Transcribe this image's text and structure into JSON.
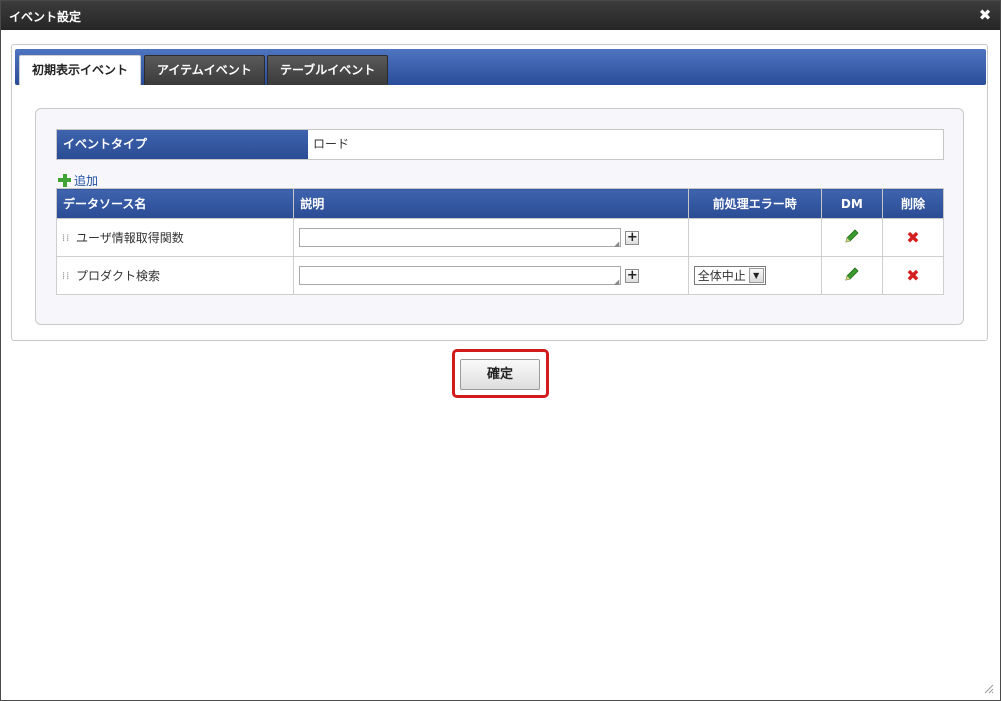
{
  "dialog": {
    "title": "イベント設定",
    "close_symbol": "✖"
  },
  "tabs": [
    {
      "label": "初期表示イベント",
      "active": true
    },
    {
      "label": "アイテムイベント",
      "active": false
    },
    {
      "label": "テーブルイベント",
      "active": false
    }
  ],
  "event_type": {
    "label": "イベントタイプ",
    "value": "ロード"
  },
  "add_link": {
    "label": "追加"
  },
  "table": {
    "columns": [
      "データソース名",
      "説明",
      "前処理エラー時",
      "DM",
      "削除"
    ],
    "rows": [
      {
        "name": "ユーザ情報取得関数",
        "description": "",
        "on_error": ""
      },
      {
        "name": "プロダクト検索",
        "description": "",
        "on_error": "全体中止"
      }
    ]
  },
  "confirm_button": {
    "label": "確定"
  },
  "colors": {
    "header_blue": "#2e51a0",
    "highlight_red": "#d21b1b",
    "pencil_green": "#3a9a2c",
    "delete_red": "#d52020"
  }
}
